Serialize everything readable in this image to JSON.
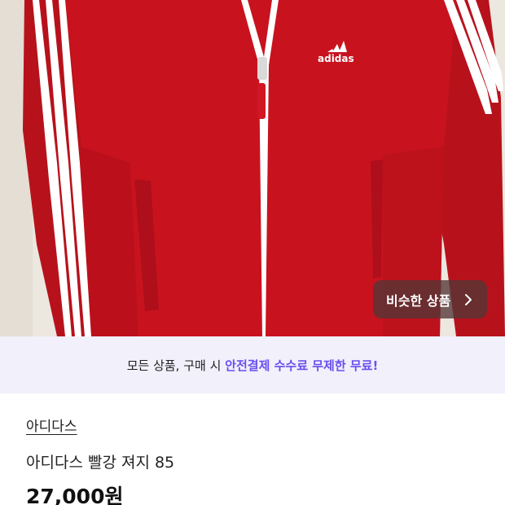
{
  "photo": {
    "logo_text": "adidas",
    "colors": {
      "jacket": "#c8131f",
      "stripe": "#ffffff",
      "wall": "#ece7df"
    }
  },
  "similar_button": {
    "label": "비슷한 상품"
  },
  "promo": {
    "prefix": "모든 상품, 구매 시 ",
    "highlight": "안전결제 수수료 무제한 무료!",
    "accent_color": "#6a4ff0"
  },
  "product": {
    "brand": "아디다스",
    "title": "아디다스 빨강 져지 85",
    "price": "27,000원"
  }
}
